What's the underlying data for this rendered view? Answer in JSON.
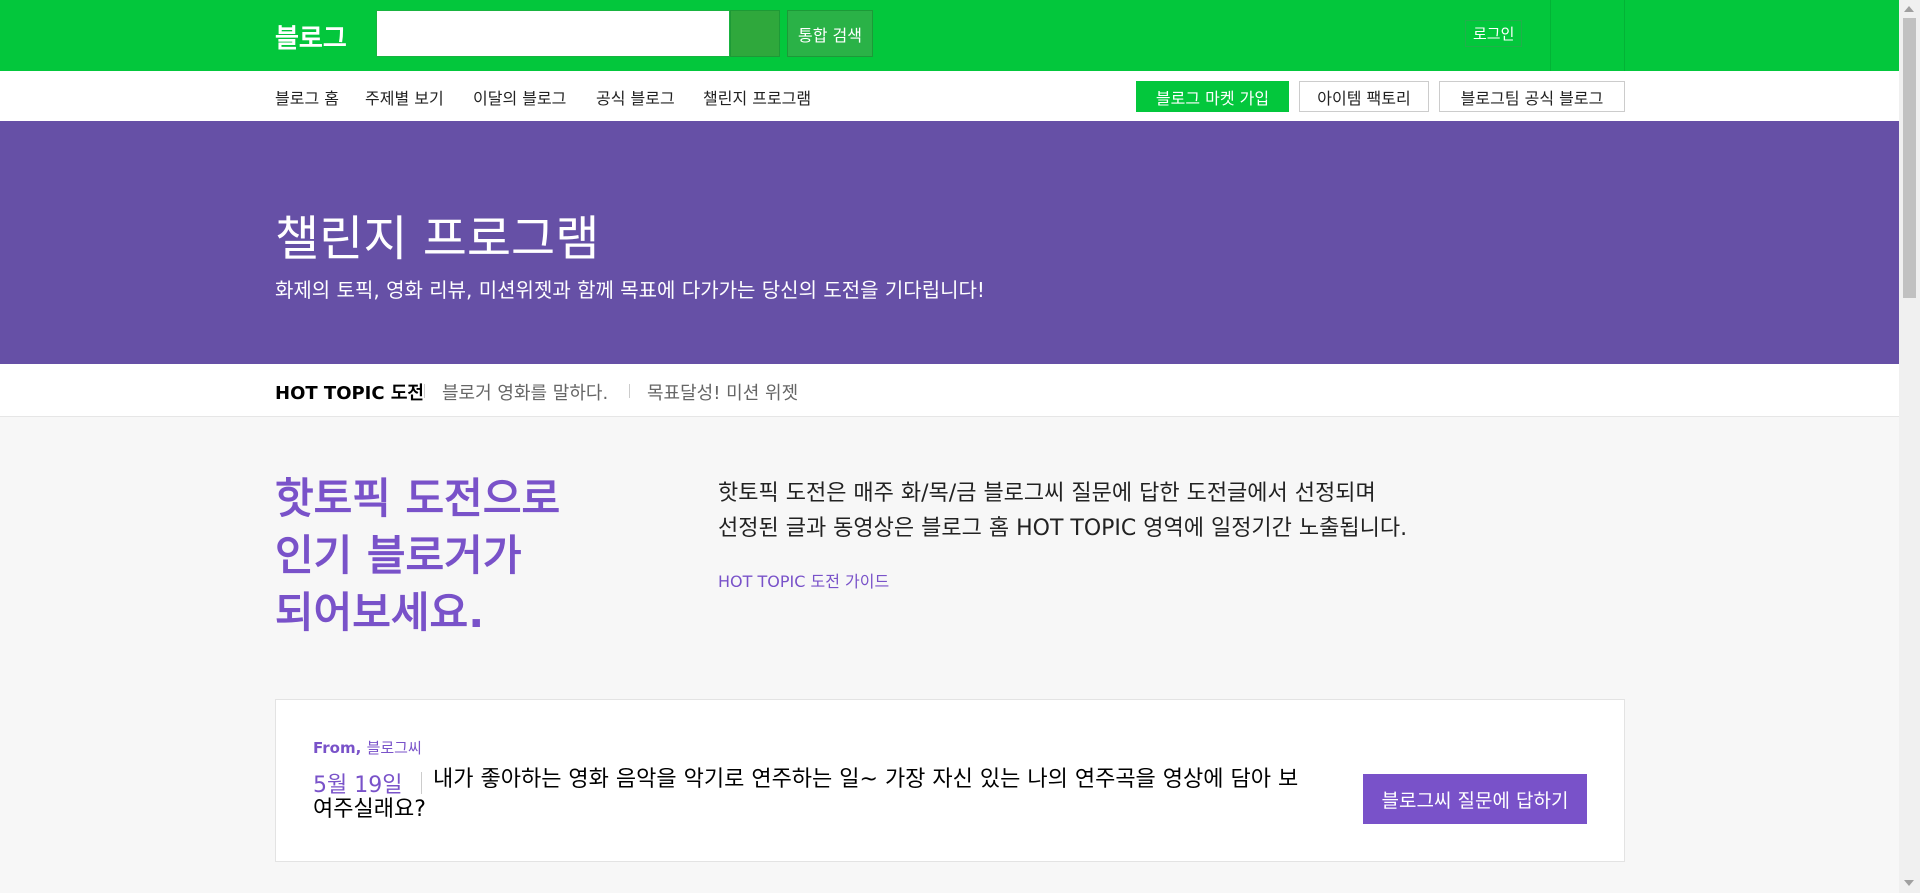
{
  "header": {
    "logo": "블로그",
    "search_placeholder": "",
    "unified_search": "통합 검색",
    "login": "로그인"
  },
  "nav": {
    "items": [
      "블로그 홈",
      "주제별 보기",
      "이달의 블로그",
      "공식 블로그",
      "챌린지 프로그램"
    ],
    "active_index": 4,
    "buttons": [
      "블로그 마켓 가입",
      "아이템 팩토리",
      "블로그팀 공식 블로그"
    ]
  },
  "hero": {
    "title": "챌린지 프로그램",
    "subtitle": "화제의 토픽, 영화 리뷰, 미션위젯과 함께 목표에 다가가는 당신의 도전을 기다립니다!"
  },
  "subtabs": {
    "items": [
      "HOT TOPIC 도전",
      "블로거 영화를 말하다.",
      "목표달성! 미션 위젯"
    ],
    "active_index": 0
  },
  "intro": {
    "headline": [
      "핫토픽 도전으로",
      "인기 블로거가",
      "되어보세요."
    ],
    "description": [
      "핫토픽 도전은 매주 화/목/금 블로그씨 질문에 답한 도전글에서 선정되며",
      "선정된 글과 동영상은 블로그 홈 HOT TOPIC 영역에 일정기간 노출됩니다."
    ],
    "guide_link": "HOT TOPIC 도전 가이드"
  },
  "card": {
    "from_label": "From,",
    "from_name": "블로그씨",
    "date": "5월 19일",
    "question": "내가 좋아하는 영화 음악을 악기로 연주하는 일~ 가장 자신 있는 나의 연주곡을 영상에 담아 보여주실래요?",
    "answer_button": "블로그씨 질문에 답하기"
  },
  "colors": {
    "header_green": "#03c73c",
    "hero_purple": "#6650a6",
    "accent_purple": "#7952c9"
  }
}
